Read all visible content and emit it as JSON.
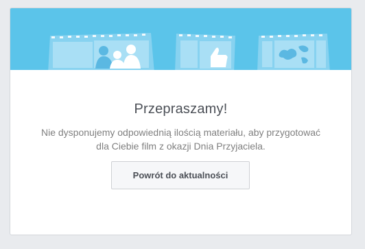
{
  "dialog": {
    "title": "Przepraszamy!",
    "message": "Nie dysponujemy odpowiednią ilością materiału, aby przygotować dla Ciebie film z okazji Dnia Przyjaciela.",
    "back_button_label": "Powrót do aktualności"
  },
  "banner": {
    "background_color": "#5bc4ea",
    "illustrations": [
      "film-strip-friends-icon",
      "film-strip-thumbsup-icon",
      "film-strip-map-icon"
    ]
  }
}
